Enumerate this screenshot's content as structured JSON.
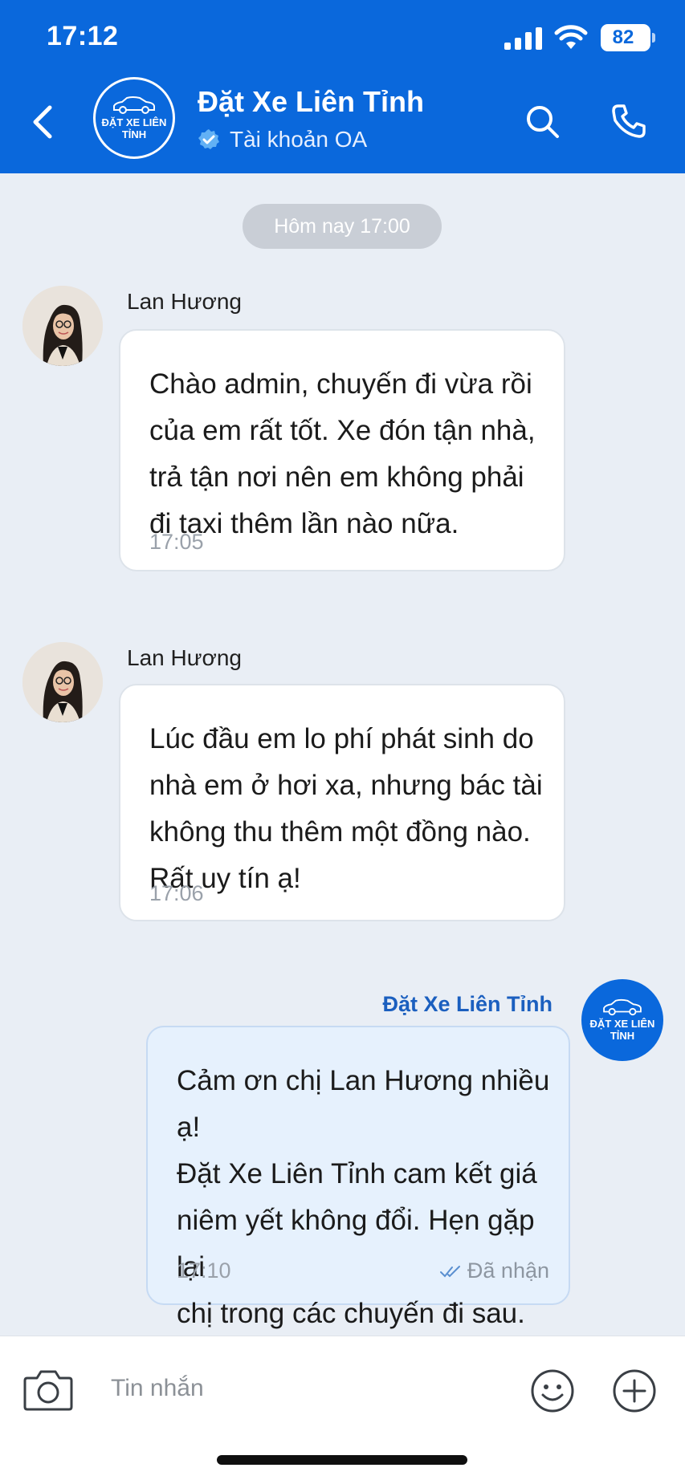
{
  "status_bar": {
    "time": "17:12",
    "battery": "82"
  },
  "header": {
    "title": "Đặt Xe Liên Tỉnh",
    "subtitle": "Tài khoản OA",
    "logo_text": "ĐẶT XE LIÊN TỈNH",
    "icons": [
      "back-arrow-icon",
      "search-icon",
      "phone-icon",
      "verified-badge-icon"
    ]
  },
  "day_separator": "Hôm nay 17:00",
  "messages": [
    {
      "sender": "Lan Hương",
      "text": "Chào admin, chuyến đi vừa rồi\ncủa em rất tốt. Xe đón tận nhà,\ntrả tận nơi nên em không phải\nđi taxi thêm lần nào nữa.",
      "time": "17:05"
    },
    {
      "sender": "Lan Hương",
      "text": "Lúc đầu em lo phí phát sinh do\nnhà em ở hơi xa, nhưng bác tài\nkhông thu thêm một đồng nào.\nRất uy tín ạ!",
      "time": "17:06"
    },
    {
      "sender": "Đặt Xe Liên Tỉnh",
      "text": "Cảm ơn chị Lan Hương nhiều ạ!\nĐặt Xe Liên Tỉnh cam kết giá\nniêm yết không đổi. Hẹn gặp lại\nchị trong các chuyến đi sau.",
      "time": "17:10",
      "status": "Đã nhận"
    }
  ],
  "composer": {
    "placeholder": "Tin nhắn",
    "icons": [
      "camera-icon",
      "emoji-icon",
      "plus-icon"
    ]
  },
  "colors": {
    "brand": "#0a68dc",
    "background": "#e9eef5",
    "outgoing_bubble": "#e6f1fd"
  }
}
